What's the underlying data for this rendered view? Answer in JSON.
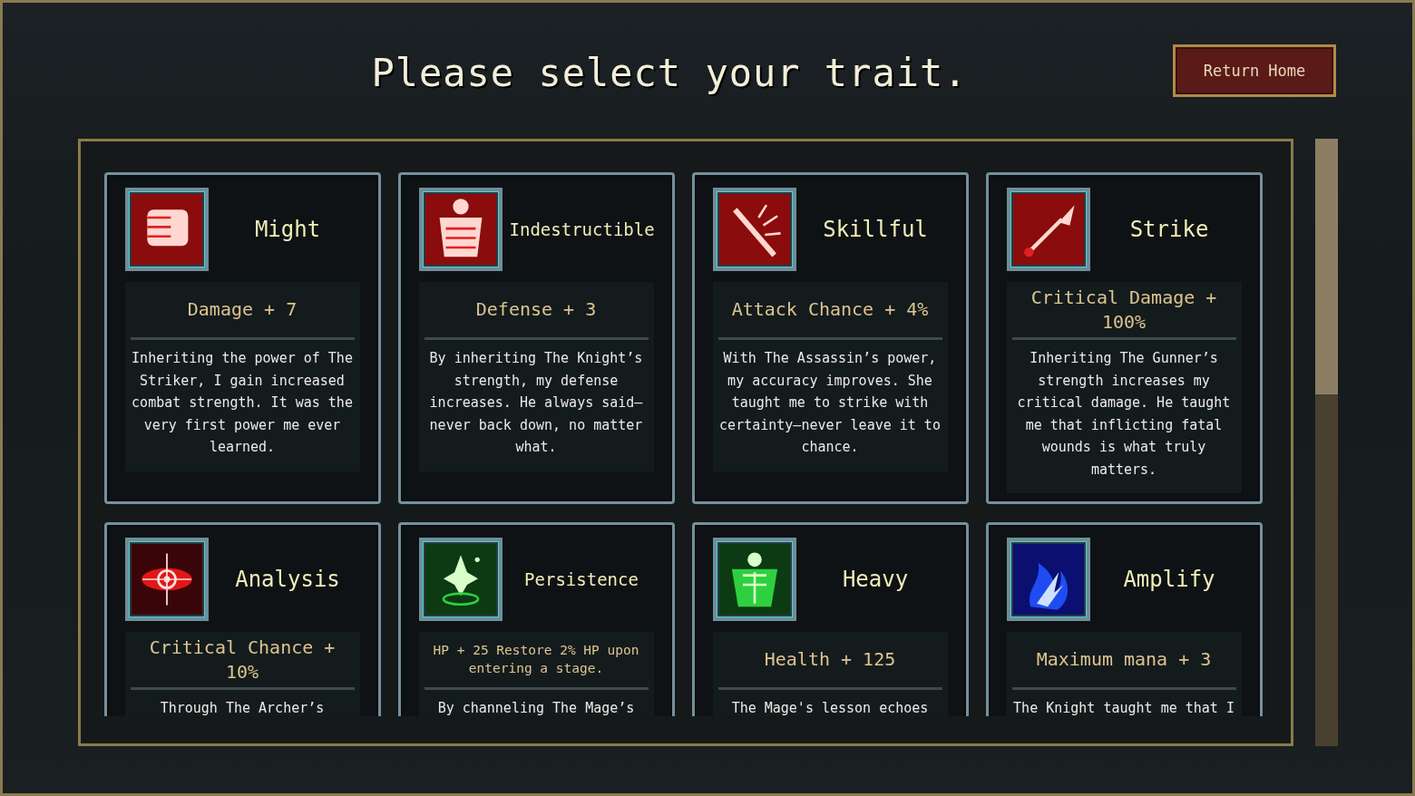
{
  "title": "Please select your trait.",
  "return_button": "Return Home",
  "traits": [
    {
      "name": "Might",
      "stat": "Damage + 7",
      "description": "Inheriting the power of The Striker, I gain increased combat strength. It was the very first power me ever learned."
    },
    {
      "name": "Indestructible",
      "stat": "Defense + 3",
      "description": "By inheriting The Knight’s strength, my defense increases. He always said—never back down, no matter what."
    },
    {
      "name": "Skillful",
      "stat": "Attack Chance + 4%",
      "description": "With The Assassin’s power, my accuracy improves. She taught me to strike with certainty—never leave it to chance."
    },
    {
      "name": "Strike",
      "stat": "Critical Damage + 100%",
      "description": "Inheriting The Gunner’s strength increases my critical damage. He taught me that inflicting fatal wounds is what truly matters."
    },
    {
      "name": "Analysis",
      "stat": "Critical Chance + 10%",
      "description": "Through The Archer’s"
    },
    {
      "name": "Persistence",
      "stat": "HP + 25 Restore 2% HP upon entering a stage.",
      "description": "By channeling The Mage’s"
    },
    {
      "name": "Heavy",
      "stat": "Health + 125",
      "description": "The Mage's lesson echoes"
    },
    {
      "name": "Amplify",
      "stat": "Maximum mana + 3",
      "description": "The Knight taught me that I"
    }
  ]
}
